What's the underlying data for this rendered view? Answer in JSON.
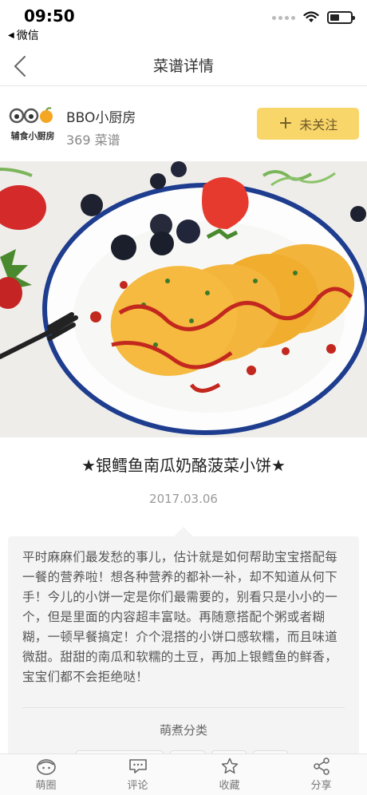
{
  "status_bar": {
    "time": "09:50",
    "back_app": "微信"
  },
  "nav": {
    "title": "菜谱详情"
  },
  "author": {
    "logo_text": "辅食小厨房",
    "name": "BBO小厨房",
    "recipe_count": "369 菜谱",
    "follow_label": "未关注"
  },
  "recipe": {
    "title": "★银鳕鱼南瓜奶酪菠菜小饼★",
    "date": "2017.03.06",
    "description": "平时麻麻们最发愁的事儿，估计就是如何帮助宝宝搭配每一餐的营养啦！想各种营养的都补一补，却不知道从何下手！今儿的小饼一定是你们最需要的，别看只是小小的一个，但是里面的内容超丰富哒。再随意搭配个粥或者糊糊，一顿早餐搞定！介个混搭的小饼口感软糯，而且味道微甜。甜甜的南瓜和软糯的土豆，再加上银鳕鱼的鲜香，宝宝们都不会拒绝哒！",
    "category_label": "萌煮分类"
  },
  "tabs": [
    {
      "label": "萌圈",
      "icon": "face-icon"
    },
    {
      "label": "评论",
      "icon": "chat-icon"
    },
    {
      "label": "收藏",
      "icon": "star-icon"
    },
    {
      "label": "分享",
      "icon": "share-icon"
    }
  ],
  "colors": {
    "follow_button": "#f8d66a",
    "follow_text": "#6f5a27",
    "card_bg": "#f4f4f4"
  }
}
